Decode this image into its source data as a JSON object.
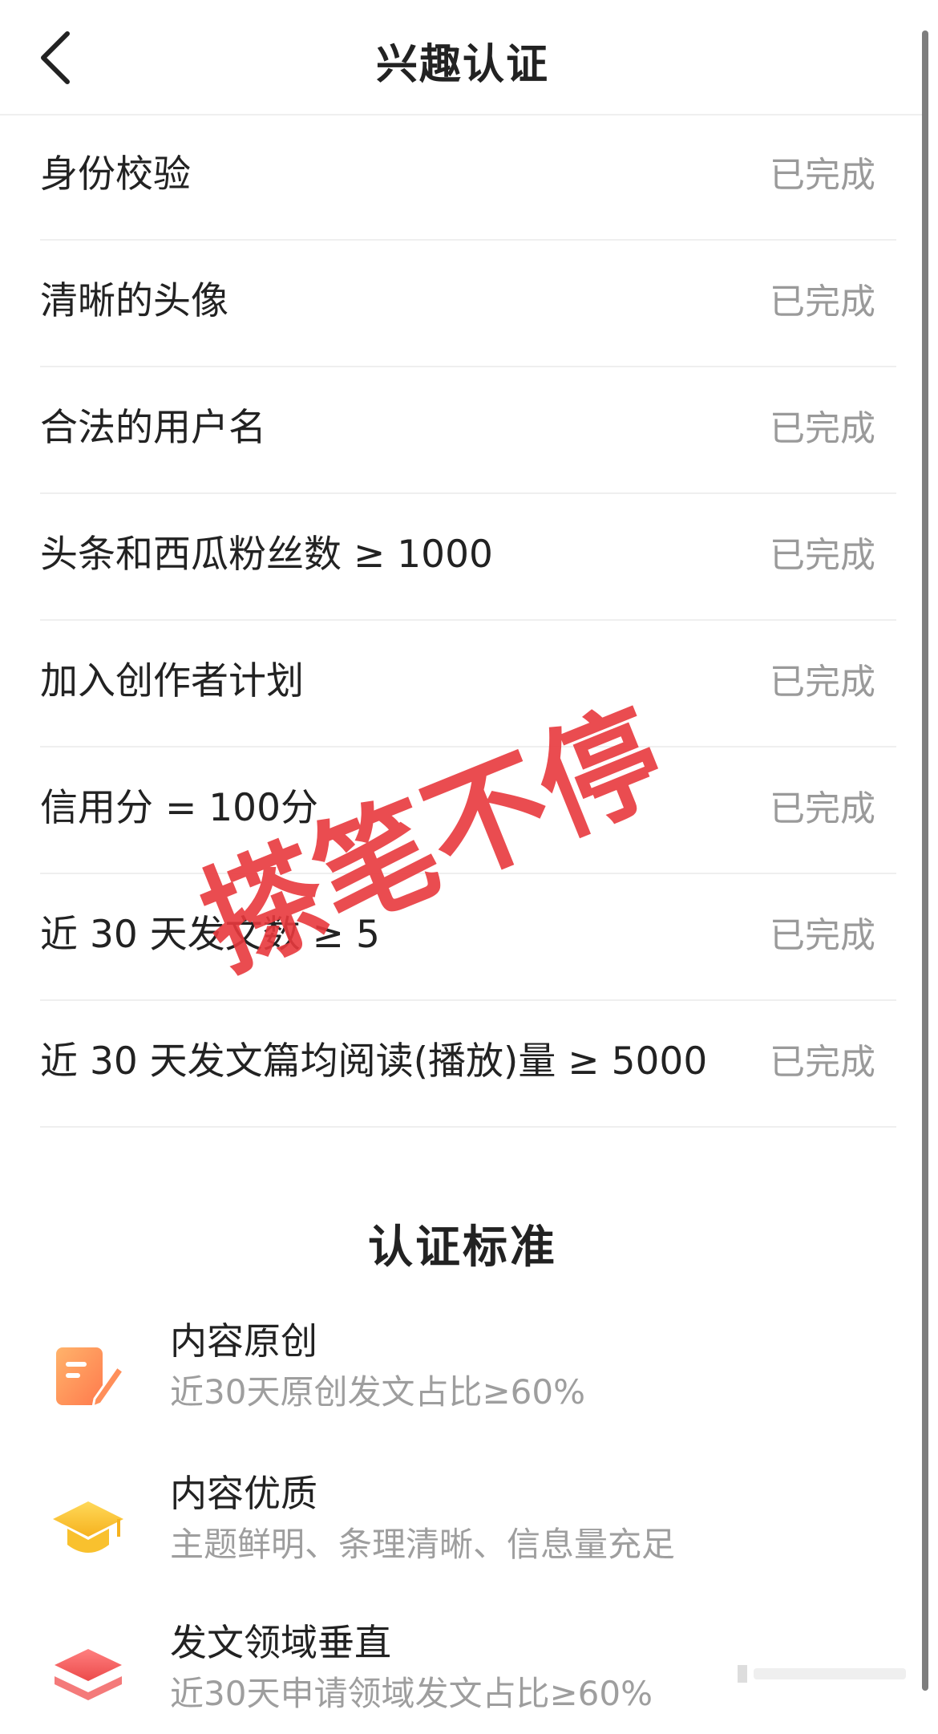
{
  "header": {
    "title": "兴趣认证"
  },
  "requirements": [
    {
      "label": "身份校验",
      "status": "已完成"
    },
    {
      "label": "清晰的头像",
      "status": "已完成"
    },
    {
      "label": "合法的用户名",
      "status": "已完成"
    },
    {
      "label": "头条和西瓜粉丝数 ≥ 1000",
      "status": "已完成"
    },
    {
      "label": "加入创作者计划",
      "status": "已完成"
    },
    {
      "label": "信用分 = 100分",
      "status": "已完成"
    },
    {
      "label": "近 30 天发文数 ≥ 5",
      "status": "已完成"
    },
    {
      "label": "近 30 天发文篇均阅读(播放)量 ≥ 5000",
      "status": "已完成"
    }
  ],
  "standards": {
    "title": "认证标准",
    "items": [
      {
        "title": "内容原创",
        "desc": "近30天原创发文占比≥60%",
        "icon": "edit-note-icon",
        "color": "#ff8f5a"
      },
      {
        "title": "内容优质",
        "desc": "主题鲜明、条理清晰、信息量充足",
        "icon": "graduation-cap-icon",
        "color": "#f9c12e"
      },
      {
        "title": "发文领域垂直",
        "desc": "近30天申请领域发文占比≥60%",
        "icon": "layers-icon",
        "color": "#f25a5a"
      }
    ]
  },
  "watermark": {
    "text": "搽笔不停",
    "color": "#e8383d"
  }
}
